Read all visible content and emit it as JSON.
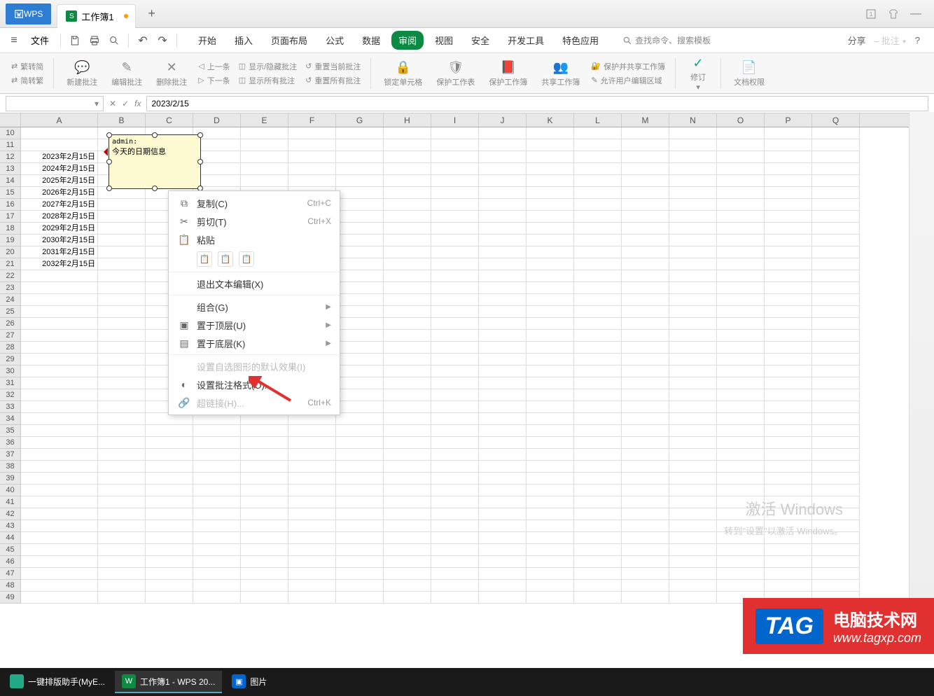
{
  "title": {
    "app": "WPS",
    "tab": "工作簿1"
  },
  "menu": {
    "file": "文件",
    "tabs": [
      "开始",
      "插入",
      "页面布局",
      "公式",
      "数据",
      "审阅",
      "视图",
      "安全",
      "开发工具",
      "特色应用"
    ],
    "active_tab": "审阅",
    "search_placeholder": "查找命令、搜索模板",
    "share": "分享",
    "comment_batch": "批注"
  },
  "ribbon": {
    "simp_trad1": "繁转简",
    "simp_trad2": "简转繁",
    "new_comment": "新建批注",
    "edit_comment": "编辑批注",
    "delete_comment": "删除批注",
    "prev": "上一条",
    "next": "下一条",
    "show_hide": "显示/隐藏批注",
    "show_all": "显示所有批注",
    "reset_current": "重置当前批注",
    "reset_all": "重置所有批注",
    "lock_cell": "锁定单元格",
    "protect_sheet": "保护工作表",
    "protect_book": "保护工作簿",
    "share_book": "共享工作簿",
    "protect_share": "保护并共享工作簿",
    "allow_edit": "允许用户编辑区域",
    "revision": "修订",
    "doc_perm": "文档权限"
  },
  "formula": {
    "name_box": "",
    "value": "2023/2/15"
  },
  "columns": [
    "A",
    "B",
    "C",
    "D",
    "E",
    "F",
    "G",
    "H",
    "I",
    "J",
    "K",
    "L",
    "M",
    "N",
    "O",
    "P",
    "Q"
  ],
  "rows_start": 10,
  "rows_end": 49,
  "data_rows": [
    "2023年2月15日",
    "2024年2月15日",
    "2025年2月15日",
    "2026年2月15日",
    "2027年2月15日",
    "2028年2月15日",
    "2029年2月15日",
    "2030年2月15日",
    "2031年2月15日",
    "2032年2月15日"
  ],
  "comment": {
    "author": "admin:",
    "text": "今天的日期信息"
  },
  "context_menu": {
    "copy": "复制(C)",
    "copy_sc": "Ctrl+C",
    "cut": "剪切(T)",
    "cut_sc": "Ctrl+X",
    "paste": "粘贴",
    "exit_edit": "退出文本编辑(X)",
    "group": "组合(G)",
    "bring_front": "置于顶层(U)",
    "send_back": "置于底层(K)",
    "default_shape": "设置自选图形的默认效果(I)",
    "format_comment": "设置批注格式(O)...",
    "hyperlink": "超链接(H)...",
    "hyperlink_sc": "Ctrl+K"
  },
  "watermark": {
    "activate": "激活 Windows",
    "goto": "转到\"设置\"以激活 Windows。"
  },
  "tag": {
    "badge": "TAG",
    "cn": "电脑技术网",
    "url": "www.tagxp.com"
  },
  "taskbar": {
    "t1": "一键排版助手(MyE...",
    "t2": "工作簿1 - WPS 20...",
    "t3": "图片"
  }
}
